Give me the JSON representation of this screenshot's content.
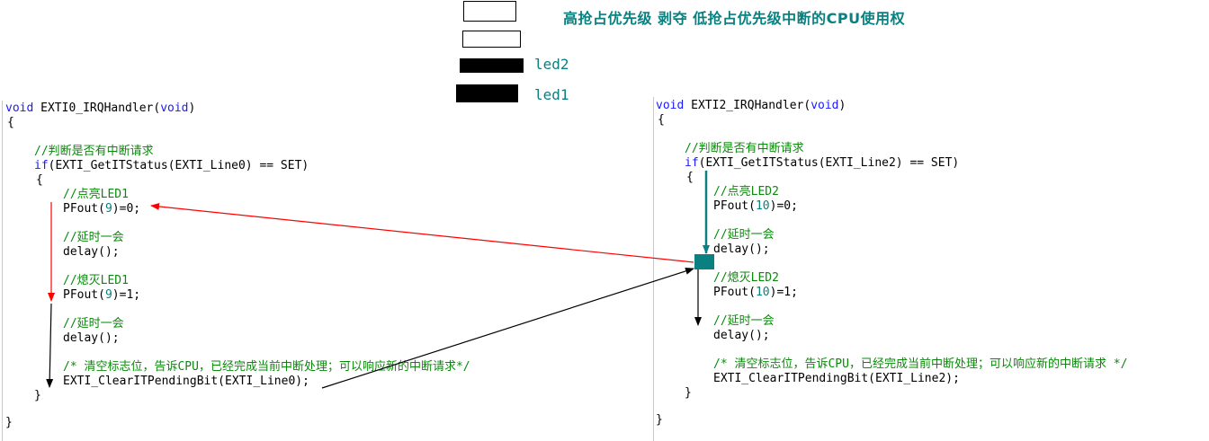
{
  "title": "高抢占优先级 剥夺 低抢占优先级中断的CPU使用权",
  "legend": {
    "led2": "led2",
    "led1": "led1"
  },
  "left": {
    "l1_kw": "void",
    "l1_name": " EXTI0_IRQHandler(",
    "l1_arg": "void",
    "l1_end": ")",
    "brace_open": "{",
    "comment_check": "//判断是否有中断请求",
    "if_kw": "if",
    "if_rest": "(EXTI_GetITStatus(EXTI_Line0) == SET)",
    "inner_open": "{",
    "comment_on": "//点亮LED1",
    "pf_on_a": "PFout(",
    "pf_on_num": "9",
    "pf_on_b": ")=0;",
    "comment_delay1": "//延时一会",
    "delay1": "delay();",
    "comment_off": "//熄灭LED1",
    "pf_off_a": "PFout(",
    "pf_off_num": "9",
    "pf_off_b": ")=1;",
    "comment_delay2": "//延时一会",
    "delay2": "delay();",
    "comment_clear": "/* 清空标志位，告诉CPU，已经完成当前中断处理；可以响应新的中断请求*/",
    "clear_call": "EXTI_ClearITPendingBit(EXTI_Line0);",
    "inner_close": "}",
    "brace_close": "}"
  },
  "right": {
    "l1_kw": "void",
    "l1_name": " EXTI2_IRQHandler(",
    "l1_arg": "void",
    "l1_end": ")",
    "brace_open": "{",
    "comment_check": "//判断是否有中断请求",
    "if_kw": "if",
    "if_rest": "(EXTI_GetITStatus(EXTI_Line2) == SET)",
    "inner_open": "{",
    "comment_on": "//点亮LED2",
    "pf_on_a": "PFout(",
    "pf_on_num": "10",
    "pf_on_b": ")=0;",
    "comment_delay1": "//延时一会",
    "delay1": "delay();",
    "comment_off": "//熄灭LED2",
    "pf_off_a": "PFout(",
    "pf_off_num": "10",
    "pf_off_b": ")=1;",
    "comment_delay2": "//延时一会",
    "delay2": "delay();",
    "comment_clear": "/* 清空标志位，告诉CPU，已经完成当前中断处理；可以响应新的中断请求 */",
    "clear_call": "EXTI_ClearITPendingBit(EXTI_Line2);",
    "inner_close": "}",
    "brace_close": "}"
  },
  "colors": {
    "teal": "#0a8080",
    "red": "#ff0000",
    "black": "#000000",
    "keyword": "#1a1aff",
    "comment": "#0a8a0a"
  }
}
